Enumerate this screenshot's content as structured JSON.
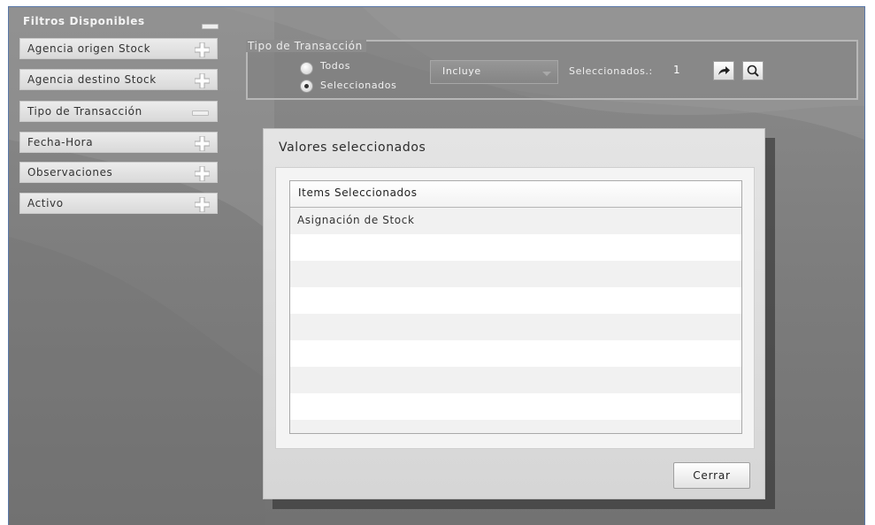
{
  "sidebar": {
    "title": "Filtros Disponibles",
    "items": [
      {
        "label": "Agencia origen Stock",
        "state": "plus-icon"
      },
      {
        "label": "Agencia destino Stock",
        "state": "plus-icon"
      },
      {
        "label": "Tipo de Transacción",
        "state": "minus-icon"
      },
      {
        "label": "Fecha-Hora",
        "state": "plus-icon"
      },
      {
        "label": "Observaciones",
        "state": "plus-icon"
      },
      {
        "label": "Activo",
        "state": "plus-icon"
      }
    ]
  },
  "filter_panel": {
    "legend": "Tipo de Transacción",
    "radio_all": "Todos",
    "radio_selected": "Seleccionados",
    "selected_option": "Seleccionados",
    "select_value": "Incluye",
    "selected_label": "Seleccionados.:",
    "selected_count": "1"
  },
  "dialog": {
    "title": "Valores seleccionados",
    "column_header": "Items Seleccionados",
    "rows": [
      "Asignación de Stock"
    ],
    "close_label": "Cerrar"
  },
  "colors": {
    "background": "#7c7c7c",
    "frame_border": "#5a78a8",
    "panel_border": "#b7b7b7",
    "dialog_bg": "#dcdcdc"
  }
}
